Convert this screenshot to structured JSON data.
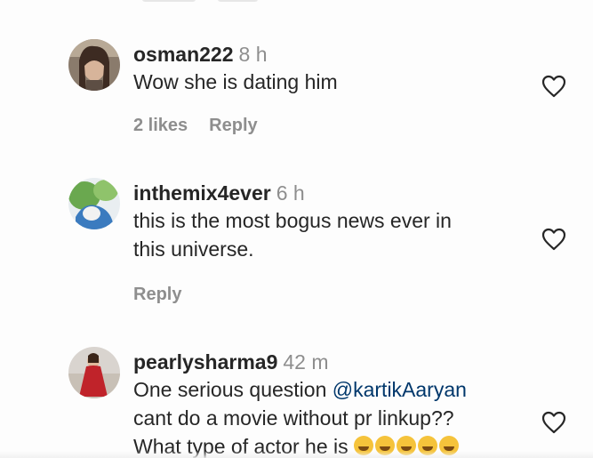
{
  "comments": [
    {
      "username": "osman222",
      "time": "8 h",
      "text": "Wow she is dating him",
      "likes": "2 likes",
      "reply": "Reply"
    },
    {
      "username": "inthemix4ever",
      "time": "6 h",
      "text_line1": "this is the most bogus news ever in",
      "text_line2": "this universe.",
      "reply": "Reply"
    },
    {
      "username": "pearlysharma9",
      "time": "42 m",
      "text_line1_pre": "One serious question ",
      "mention": "@kartikAaryan",
      "text_line2": "cant do a movie without pr linkup??",
      "text_line3": "What type of actor he is"
    }
  ],
  "icons": {
    "like": "heart-outline-icon"
  },
  "colors": {
    "username": "#262626",
    "meta": "#8e8e8e",
    "mention": "#00376b"
  }
}
